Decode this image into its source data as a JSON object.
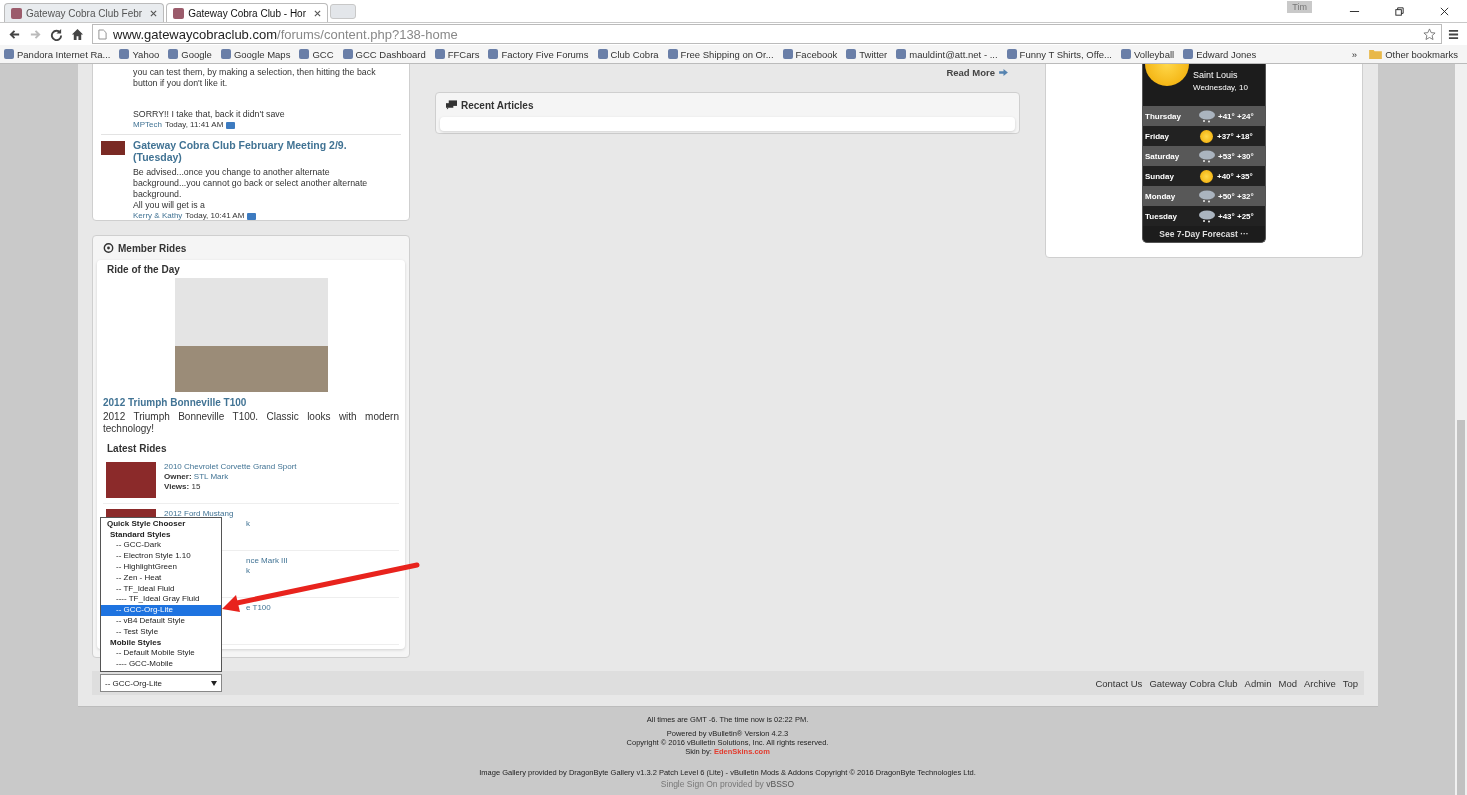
{
  "browser": {
    "tabs": [
      {
        "title": "Gateway Cobra Club Febr",
        "selected": false
      },
      {
        "title": "Gateway Cobra Club - Hor",
        "selected": true
      }
    ],
    "profile": "Tim",
    "url": {
      "host": "www.gatewaycobraclub.com",
      "path": "/forums/content.php?138-home"
    },
    "bookmarks": [
      "Pandora Internet Ra...",
      "Yahoo",
      "Google",
      "Google Maps",
      "GCC",
      "GCC Dashboard",
      "FFCars",
      "Factory Five Forums",
      "Club Cobra",
      "Free Shipping on Or...",
      "Facebook",
      "Twitter",
      "mauldint@att.net - ...",
      "Funny T Shirts, Offe...",
      "Volleyball",
      "Edward Jones"
    ],
    "bookmarks_overflow": "»",
    "other_bookmarks": "Other bookmarks"
  },
  "recent_posts": [
    {
      "thumbnail": false,
      "body": [
        "you can test them, by making a selection, then hitting the back button if you don't like it.",
        "SORRY!! I take that, back it didn't save"
      ],
      "author": "MPTech",
      "time": "Today, 11:41 AM"
    },
    {
      "thumbnail": true,
      "title": "Gateway Cobra Club February Meeting 2/9. (Tuesday)",
      "body": [
        "Be advised...once you change to another alternate background...you cannot go back or select another alternate background.",
        "All you will get is a"
      ],
      "author": "Kerry & Kathy",
      "time": "Today, 10:41 AM"
    }
  ],
  "member_rides": {
    "title": "Member Rides",
    "ride_of_day_heading": "Ride of the Day",
    "ride_title": "2012 Triumph Bonneville T100",
    "ride_description": "2012 Triumph Bonneville T100. Classic looks with modern technology!",
    "latest_heading": "Latest Rides",
    "latest": [
      {
        "thumbnail": true,
        "title": "2010 Chevrolet Corvette Grand Sport",
        "owner_label": "Owner:",
        "owner": "STL Mark",
        "views_label": "Views:",
        "views": "15"
      },
      {
        "thumbnail": true,
        "title": "2012 Ford Mustang",
        "owner_fragment": "k"
      },
      {
        "title_fragment": "nce Mark III",
        "owner_fragment": "k"
      },
      {
        "title_fragment": "e T100"
      }
    ]
  },
  "read_more": "Read More",
  "recent_articles": {
    "title": "Recent Articles"
  },
  "weather": {
    "city": "Saint Louis",
    "date": "Wednesday, 10",
    "days": [
      {
        "day": "Thursday",
        "kind": "snow",
        "temps": "+41° +24°"
      },
      {
        "day": "Friday",
        "kind": "sun",
        "temps": "+37° +18°"
      },
      {
        "day": "Saturday",
        "kind": "snow",
        "temps": "+53° +30°"
      },
      {
        "day": "Sunday",
        "kind": "sun",
        "temps": "+40° +35°"
      },
      {
        "day": "Monday",
        "kind": "snow",
        "temps": "+50° +32°"
      },
      {
        "day": "Tuesday",
        "kind": "snow",
        "temps": "+43° +25°"
      }
    ],
    "forecast_link": "See 7-Day Forecast ···"
  },
  "style_chooser": {
    "value": "-- GCC-Org-Lite",
    "options": [
      {
        "kind": "heading",
        "label": "Quick Style Chooser",
        "selected": false
      },
      {
        "kind": "group",
        "label": "Standard Styles",
        "selected": false
      },
      {
        "kind": "option",
        "label": "-- GCC-Dark",
        "selected": false
      },
      {
        "kind": "option",
        "label": "-- Electron Style 1.10",
        "selected": false
      },
      {
        "kind": "option",
        "label": "-- HighlightGreen",
        "selected": false
      },
      {
        "kind": "option",
        "label": "-- Zen - Heat",
        "selected": false
      },
      {
        "kind": "option",
        "label": "-- TF_Ideal Fluid",
        "selected": false
      },
      {
        "kind": "option",
        "label": "---- TF_Ideal Gray Fluid",
        "selected": false
      },
      {
        "kind": "option",
        "label": "-- GCC-Org-Lite",
        "selected": true
      },
      {
        "kind": "option",
        "label": "-- vB4 Default Style",
        "selected": false
      },
      {
        "kind": "option",
        "label": "-- Test Style",
        "selected": false
      },
      {
        "kind": "group",
        "label": "Mobile Styles",
        "selected": false
      },
      {
        "kind": "option",
        "label": "-- Default Mobile Style",
        "selected": false
      },
      {
        "kind": "option",
        "label": "---- GCC-Mobile",
        "selected": false
      }
    ]
  },
  "footer_links": [
    "Contact Us",
    "Gateway Cobra Club",
    "Admin",
    "Mod",
    "Archive",
    "Top"
  ],
  "footer": {
    "time_note": "All times are GMT -6. The time now is 02:22 PM.",
    "powered": "Powered by vBulletin® Version 4.2.3",
    "copyright": "Copyright © 2016 vBulletin Solutions, Inc. All rights reserved.",
    "skin_label": "Skin by:",
    "skin_link": "EdenSkins.com",
    "gallery": "Image Gallery provided by DragonByte Gallery v1.3.2 Patch Level 6 (Lite) - vBulletin Mods & Addons Copyright © 2016 DragonByte Technologies Ltd.",
    "sso_label": "Single Sign On provided by",
    "sso_link": "vBSSO"
  }
}
